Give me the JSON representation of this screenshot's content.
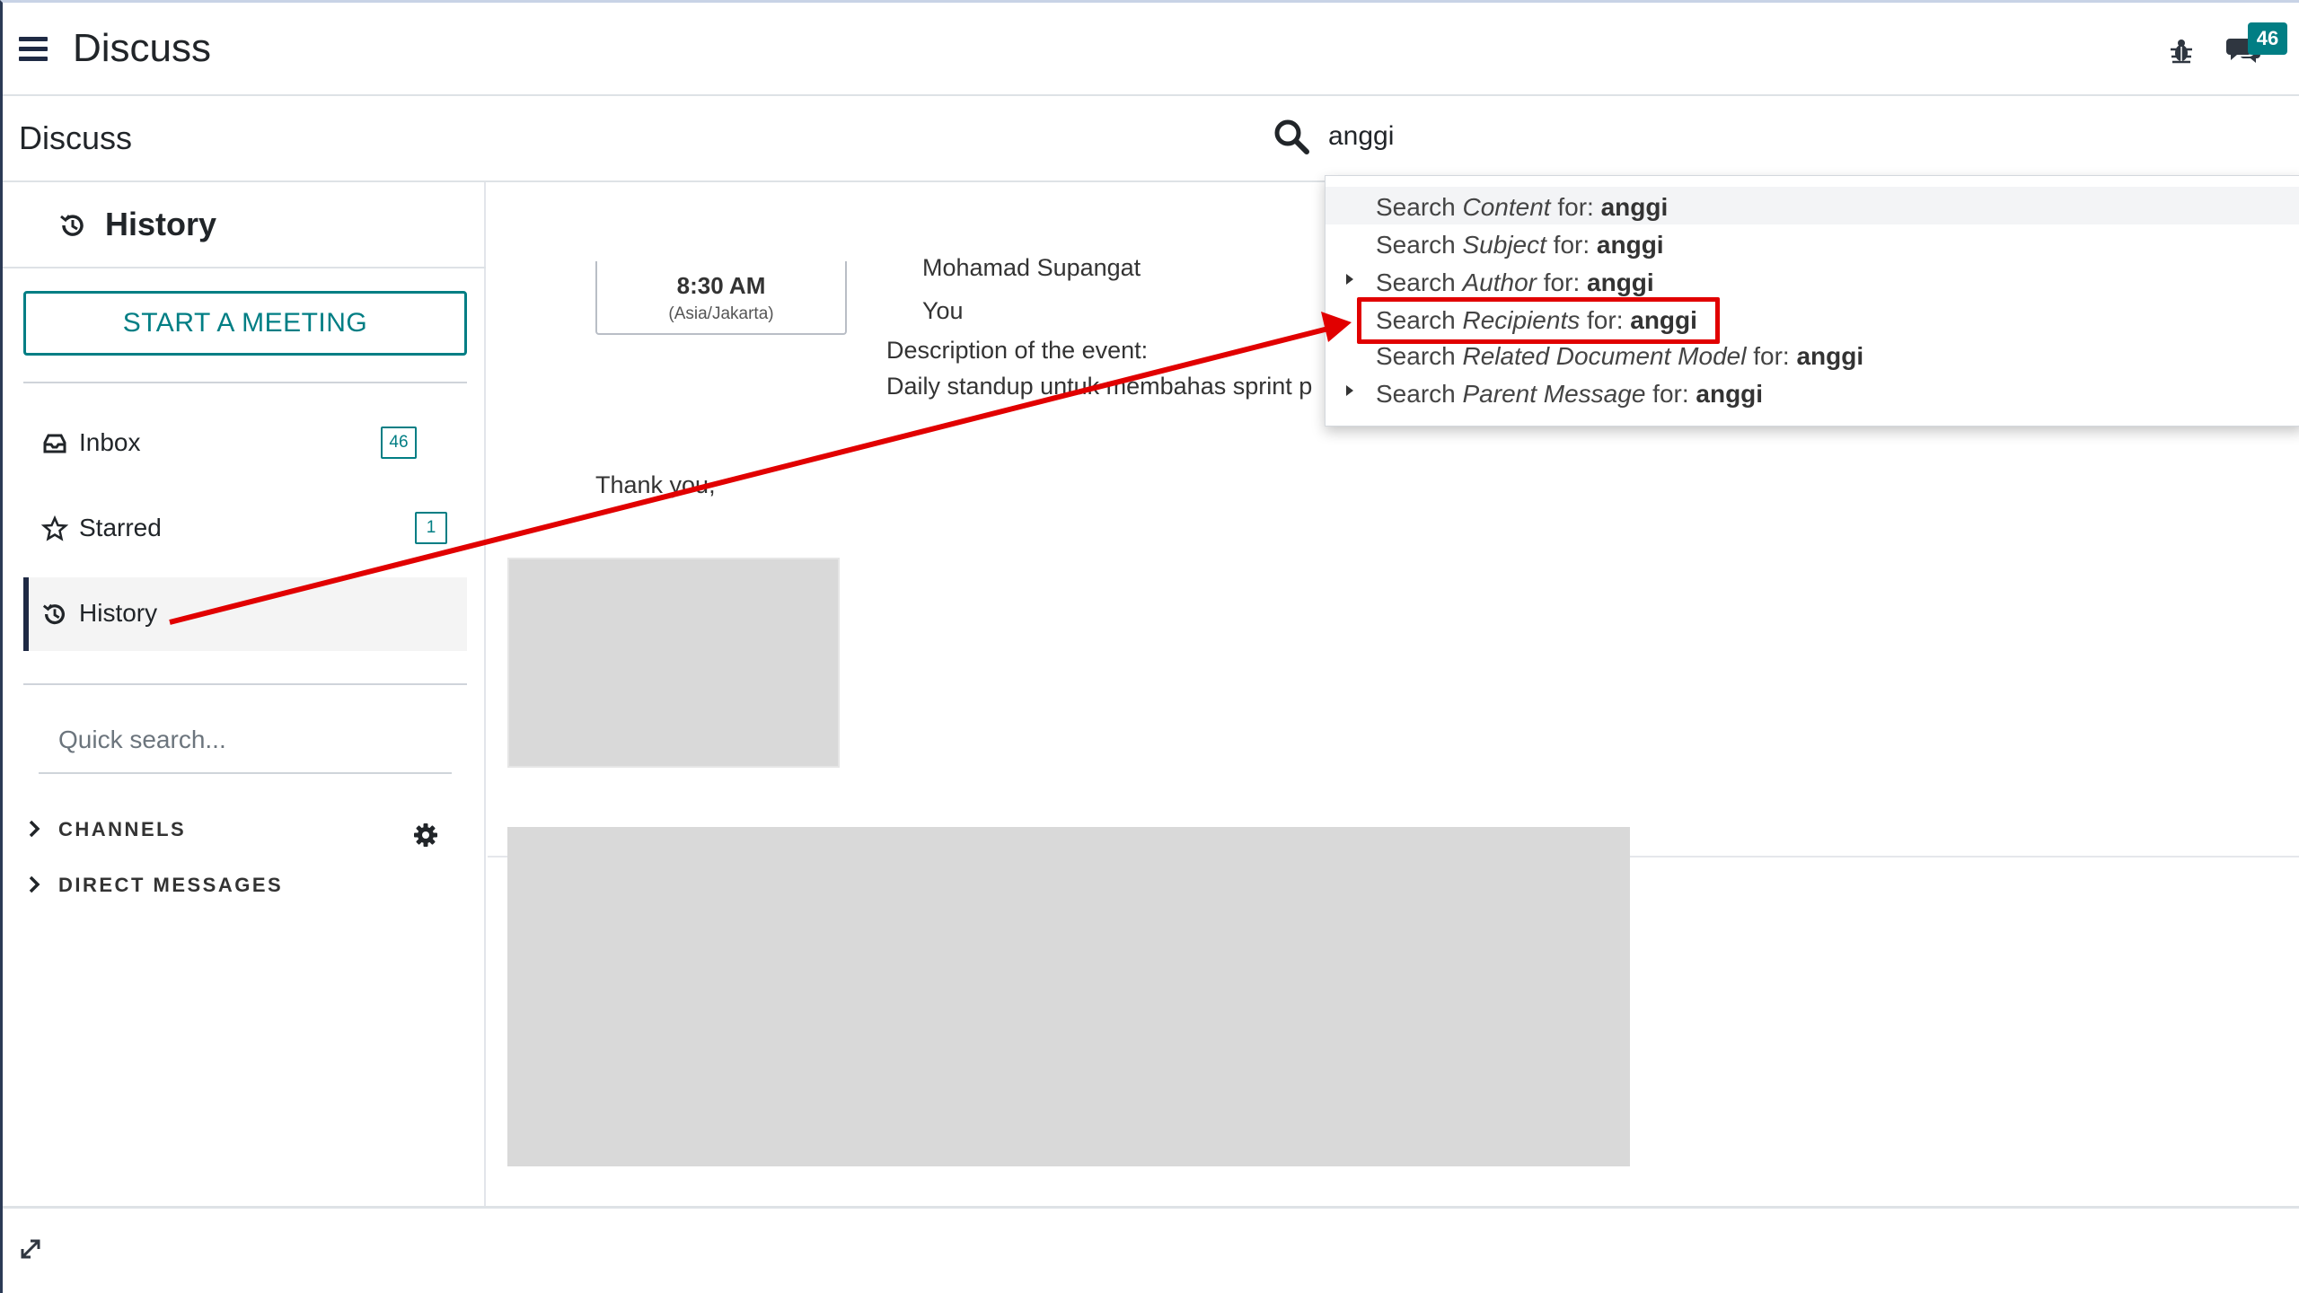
{
  "navbar": {
    "app_title": "Discuss",
    "menu_icon": "hamburger-menu-icon",
    "debug_icon": "bug-icon",
    "messaging_icon": "chat-bubbles-icon",
    "messaging_badge": "46"
  },
  "control_panel": {
    "breadcrumb": "Discuss",
    "search_icon": "search-icon",
    "search_value": "anggi"
  },
  "search_suggestions": [
    {
      "prefix": "Search ",
      "field": "Content",
      "middle": " for: ",
      "query": "anggi",
      "expandable": false
    },
    {
      "prefix": "Search ",
      "field": "Subject",
      "middle": " for: ",
      "query": "anggi",
      "expandable": false
    },
    {
      "prefix": "Search ",
      "field": "Author",
      "middle": " for: ",
      "query": "anggi",
      "expandable": true
    },
    {
      "prefix": "Search ",
      "field": "Recipients",
      "middle": " for: ",
      "query": "anggi",
      "expandable": false
    },
    {
      "prefix": "Search ",
      "field": "Related Document Model",
      "middle": " for: ",
      "query": "anggi",
      "expandable": false
    },
    {
      "prefix": "Search ",
      "field": "Parent Message",
      "middle": " for: ",
      "query": "anggi",
      "expandable": true
    }
  ],
  "sidebar": {
    "header_title": "History",
    "start_meeting_label": "START A MEETING",
    "items": [
      {
        "label": "Inbox",
        "icon": "inbox-icon",
        "count": "46"
      },
      {
        "label": "Starred",
        "icon": "star-icon",
        "count": "1"
      },
      {
        "label": "History",
        "icon": "history-icon",
        "count": ""
      }
    ],
    "quick_search_placeholder": "Quick search...",
    "categories": [
      {
        "label": "CHANNELS",
        "icon": "chevron-right-icon"
      },
      {
        "label": "DIRECT MESSAGES",
        "icon": "chevron-right-icon"
      }
    ],
    "channels_settings_icon": "gear-icon"
  },
  "thread": {
    "event_time": "8:30 AM",
    "event_timezone": "(Asia/Jakarta)",
    "attendee_1": "Mohamad Supangat",
    "attendee_2": "You",
    "description_label": "Description of the event:",
    "description_text": "Daily standup untuk membahas sprint p",
    "closing": "Thank you,"
  },
  "footer": {
    "expand_icon": "expand-icon"
  },
  "colors": {
    "accent": "#017e84",
    "annotation": "#e10000",
    "nav_dark": "#1f2a44"
  }
}
